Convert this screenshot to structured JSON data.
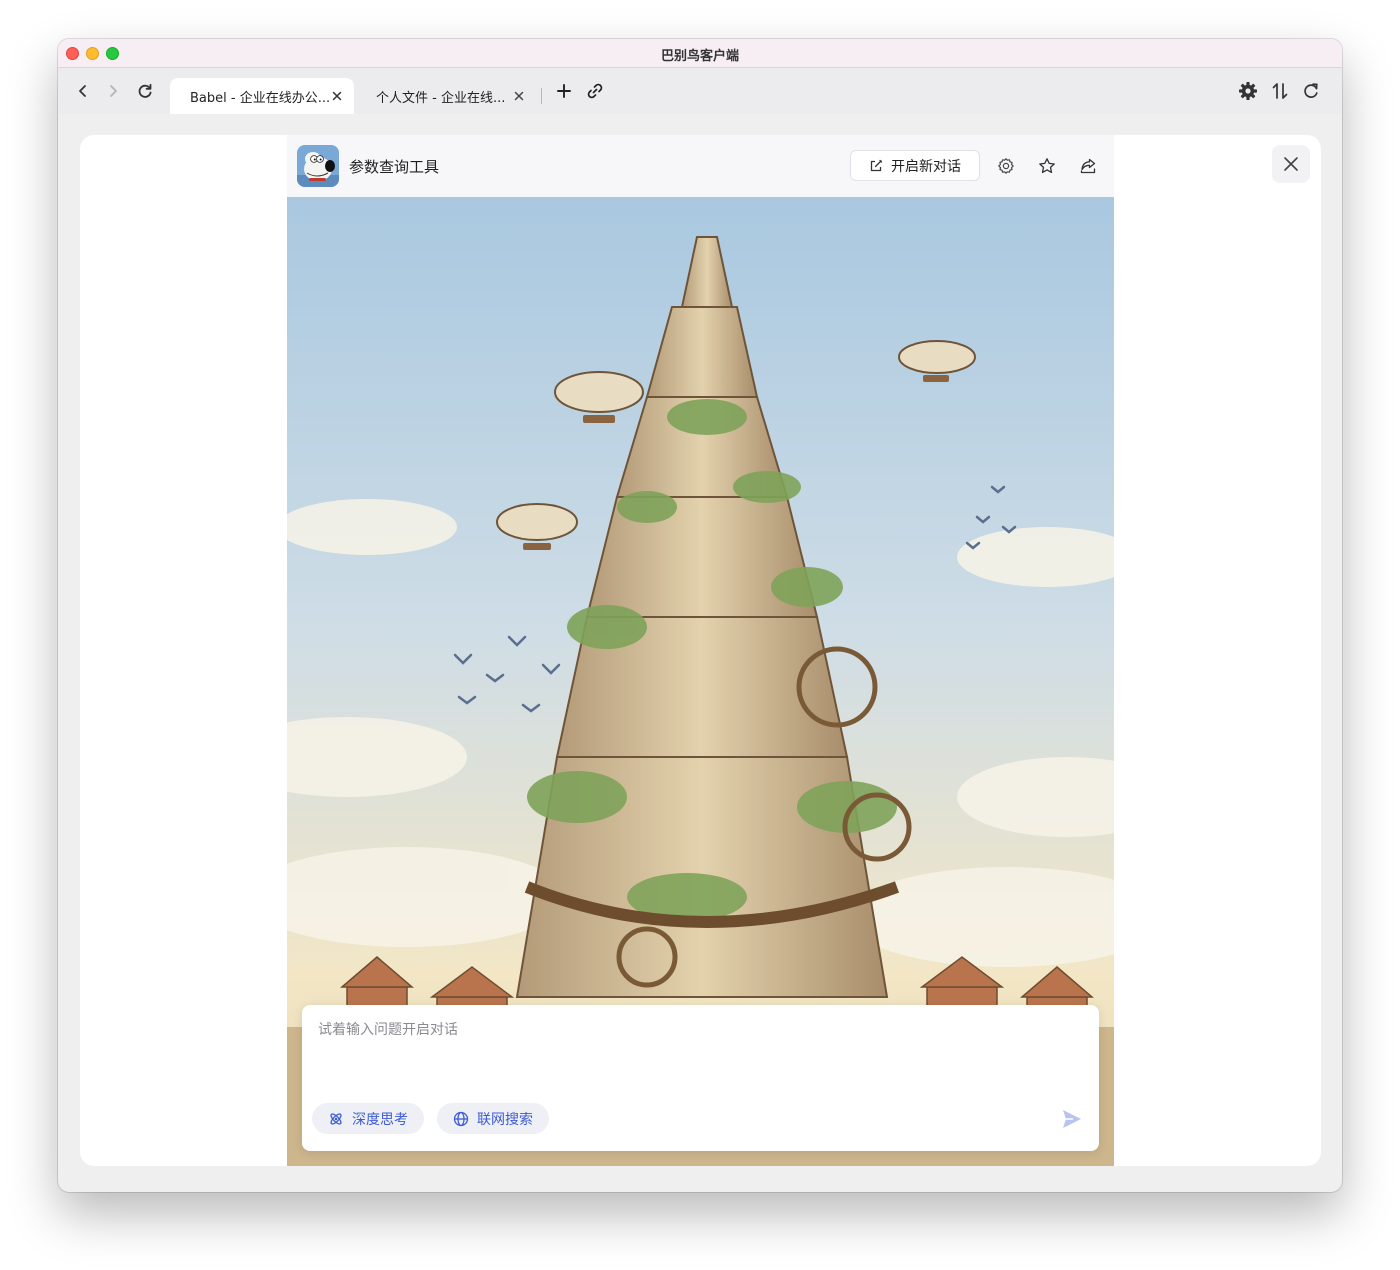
{
  "window": {
    "title": "巴别鸟客户端"
  },
  "nav": {
    "back_icon": "chevron-left-icon",
    "forward_icon": "chevron-right-icon",
    "reload_icon": "reload-icon"
  },
  "tabs": [
    {
      "label": "Babel - 企业在线办公...",
      "active": true
    },
    {
      "label": "个人文件 - 企业在线...",
      "active": false
    }
  ],
  "tab_actions": {
    "new_tab_icon": "plus-icon",
    "link_icon": "link-icon"
  },
  "toolbar_right": {
    "settings_icon": "gear-icon",
    "transfer_icon": "transfer-icon",
    "sync_icon": "sync-icon"
  },
  "app": {
    "name": "参数查询工具",
    "new_chat_label": "开启新对话",
    "header_icons": [
      "settings-outline-icon",
      "star-icon",
      "share-icon"
    ]
  },
  "input": {
    "placeholder": "试着输入问题开启对话",
    "value": "",
    "deep_think_label": "深度思考",
    "web_search_label": "联网搜索"
  },
  "colors": {
    "accent": "#3d5bd6",
    "send_disabled": "#b9c4ee",
    "tab_bar": "#ececee",
    "title_bar": "#f6eef3"
  }
}
